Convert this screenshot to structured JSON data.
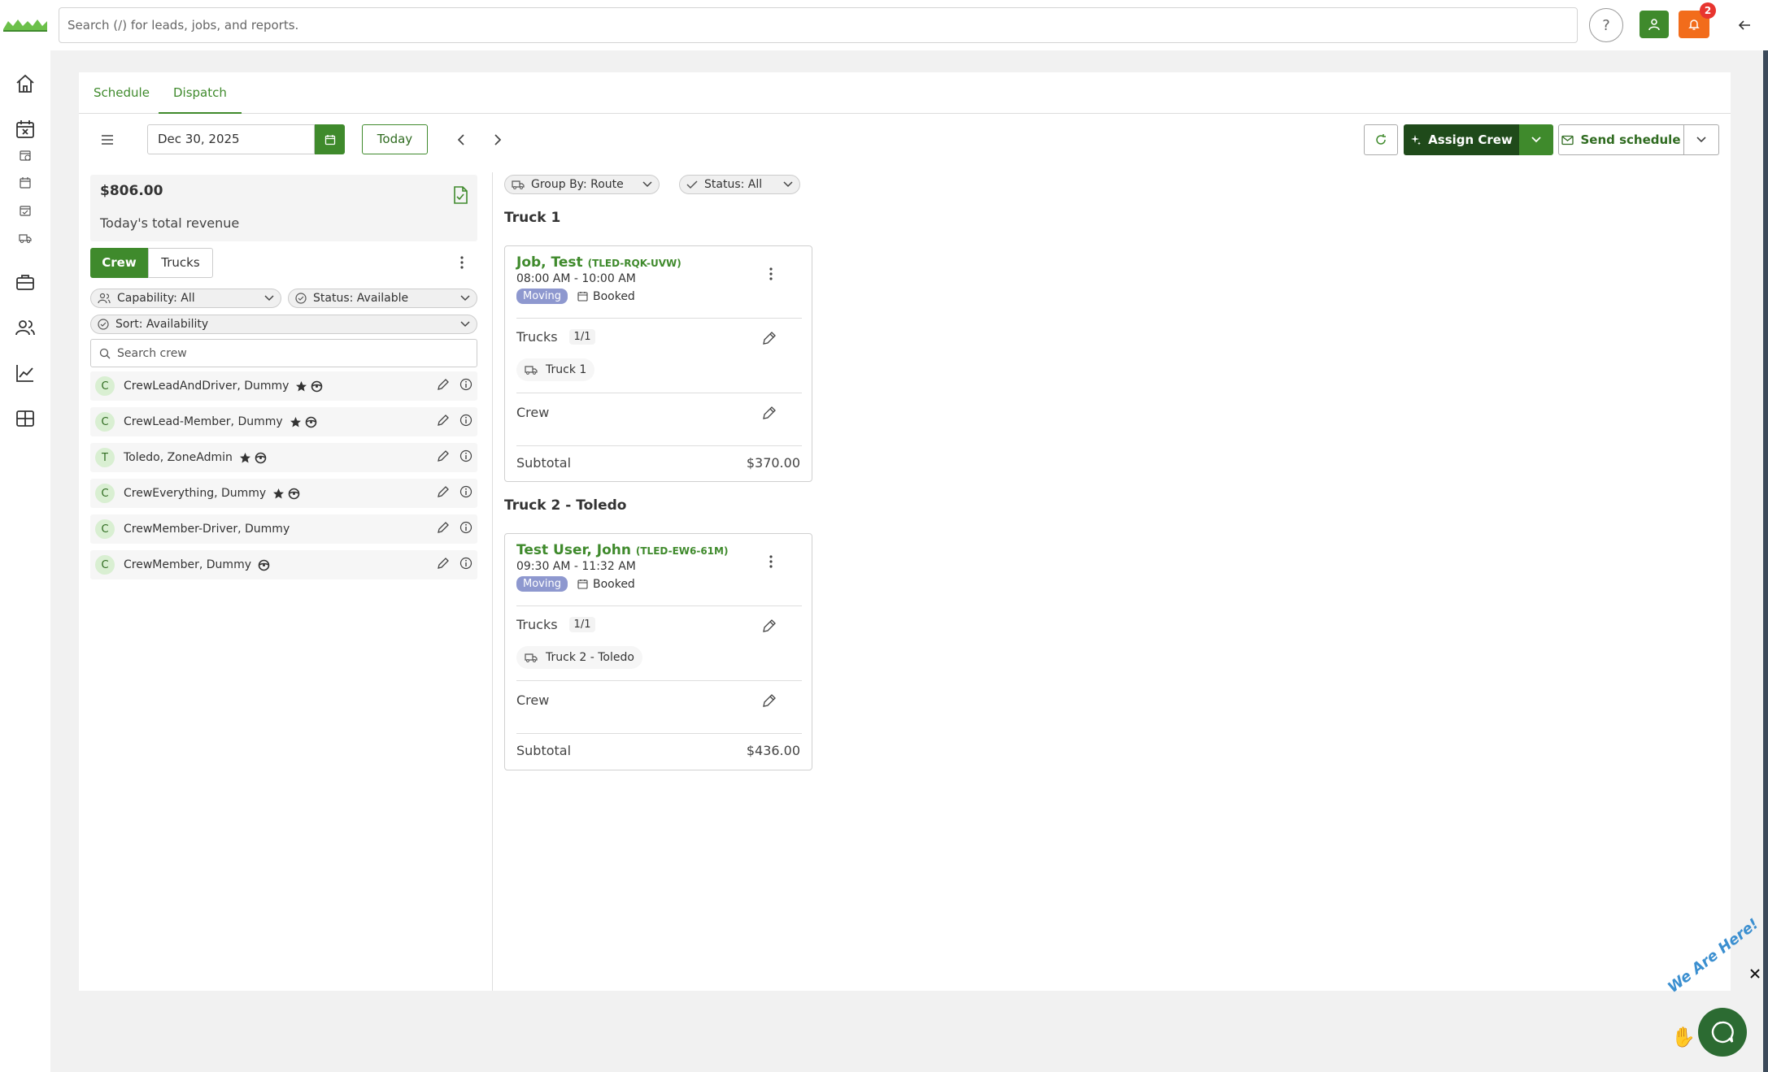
{
  "topbar": {
    "search_placeholder": "Search (/) for leads, jobs, and reports.",
    "notification_count": "2"
  },
  "tabs": [
    {
      "label": "Schedule",
      "active": false
    },
    {
      "label": "Dispatch",
      "active": true
    }
  ],
  "toolbar": {
    "date_value": "Dec 30, 2025",
    "today_label": "Today",
    "assign_crew_label": "Assign Crew",
    "send_schedule_label": "Send schedule"
  },
  "revenue": {
    "amount": "$806.00",
    "label": "Today's total revenue"
  },
  "crew_panel": {
    "segment_crew": "Crew",
    "segment_trucks": "Trucks",
    "capability_filter": "Capability: All",
    "status_filter": "Status: Available",
    "sort_filter": "Sort: Availability",
    "search_placeholder": "Search crew",
    "members": [
      {
        "initial": "C",
        "name": "CrewLeadAndDriver, Dummy",
        "star": true,
        "wheel": true
      },
      {
        "initial": "C",
        "name": "CrewLead-Member, Dummy",
        "star": true,
        "wheel": true
      },
      {
        "initial": "T",
        "name": "Toledo, ZoneAdmin",
        "star": true,
        "wheel": true
      },
      {
        "initial": "C",
        "name": "CrewEverything, Dummy",
        "star": true,
        "wheel": true
      },
      {
        "initial": "C",
        "name": "CrewMember-Driver, Dummy",
        "star": false,
        "wheel": false
      },
      {
        "initial": "C",
        "name": "CrewMember, Dummy",
        "star": false,
        "wheel": true
      }
    ]
  },
  "dispatch": {
    "group_by_filter": "Group By: Route",
    "status_filter": "Status: All",
    "groups": [
      {
        "title": "Truck 1",
        "job": {
          "name": "Job, Test",
          "code": "(TLED-RQK-UVW)",
          "time": "08:00 AM - 10:00 AM",
          "type_tag": "Moving",
          "status": "Booked",
          "trucks_label": "Trucks",
          "trucks_count": "1/1",
          "truck_name": "Truck 1",
          "crew_label": "Crew",
          "subtotal_label": "Subtotal",
          "subtotal_value": "$370.00"
        }
      },
      {
        "title": "Truck 2 - Toledo",
        "job": {
          "name": "Test User, John",
          "code": "(TLED-EW6-61M)",
          "time": "09:30 AM - 11:32 AM",
          "type_tag": "Moving",
          "status": "Booked",
          "trucks_label": "Trucks",
          "trucks_count": "1/1",
          "truck_name": "Truck 2 - Toledo",
          "crew_label": "Crew",
          "subtotal_label": "Subtotal",
          "subtotal_value": "$436.00"
        }
      }
    ]
  },
  "chat": {
    "prompt": "We Are Here!"
  },
  "colors": {
    "brand_green": "#3f8a2c",
    "dark_green": "#1f4a1a",
    "notification_orange": "#f26c1b",
    "moving_tag": "#8e98cf"
  }
}
